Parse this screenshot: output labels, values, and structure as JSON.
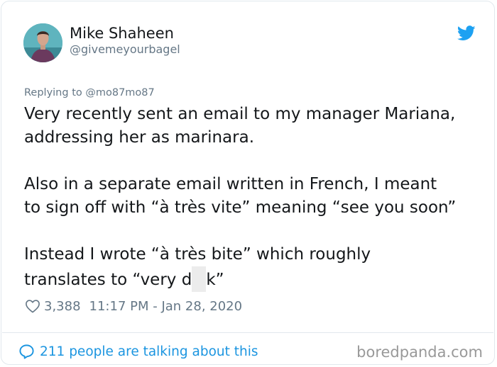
{
  "user": {
    "display_name": "Mike Shaheen",
    "handle": "@givemeyourbagel"
  },
  "reply": {
    "text": "Replying to @mo87mo87"
  },
  "tweet": {
    "paragraph1_line1": "Very recently sent an email to my manager Mariana,",
    "paragraph1_line2": "addressing her as marinara.",
    "paragraph2_line1": "Also in a separate email written in French, I meant",
    "paragraph2_line2": "to sign off with “à très vite” meaning “see you soon”",
    "paragraph3_line1": "Instead I wrote “à très bite” which roughly",
    "paragraph3_line2_before": "translates to “very d",
    "paragraph3_line2_after": "k”"
  },
  "meta": {
    "likes": "3,388",
    "timestamp": "11:17 PM - Jan 28, 2020"
  },
  "footer": {
    "conversation_text": "211 people are talking about this",
    "watermark": "boredpanda.com"
  },
  "icons": {
    "brand_logo": "twitter-bird-icon",
    "like": "heart-icon",
    "conversation": "comment-bubble-icon"
  },
  "colors": {
    "twitter_blue": "#1da1f2",
    "link_blue": "#1b95e0",
    "secondary_text": "#657786",
    "primary_text": "#14171a",
    "border": "#e1e8ed"
  }
}
